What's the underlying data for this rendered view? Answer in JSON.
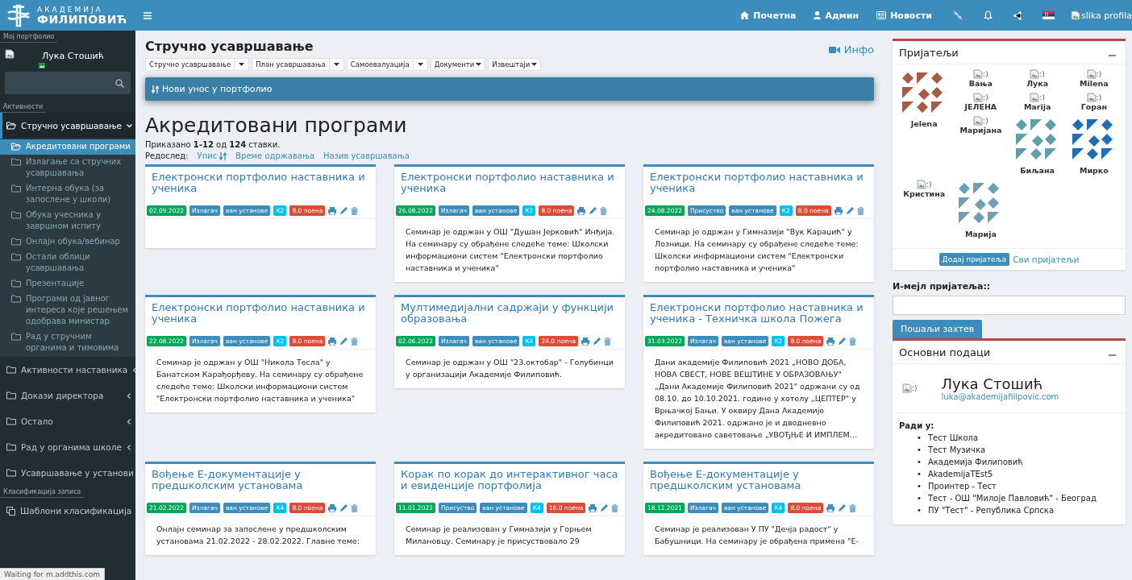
{
  "topbar": {
    "brand_top": "АКАДЕМИЈА",
    "brand_bottom": "ФИЛИПОВИЋ",
    "nav": [
      {
        "label": "Почетна"
      },
      {
        "label": "Админ"
      },
      {
        "label": "Новости"
      }
    ],
    "profile_alt": "slika profila"
  },
  "sidebar": {
    "portfolio_label": "Мој портфолио",
    "user_name": "Лука Стошић",
    "activities_label": "Активности",
    "tree": [
      {
        "label": "Стручно усавршавање",
        "expanded": true,
        "selected": false,
        "children": [
          {
            "label": "Акредитовани програми",
            "selected": true
          },
          {
            "label": "Излагање са стручних усавршавања",
            "selected": false
          },
          {
            "label": "Интерна обука (за запослене у школи)",
            "selected": false
          },
          {
            "label": "Обука учесника у завршном испиту",
            "selected": false
          },
          {
            "label": "Онлајн обука/вебинар",
            "selected": false
          },
          {
            "label": "Остали облици усавршавања",
            "selected": false
          },
          {
            "label": "Презентације",
            "selected": false
          },
          {
            "label": "Програми од јавног интереса које решењем одобрава министар",
            "selected": false
          },
          {
            "label": "Рад у стручним органима и тимовима",
            "selected": false
          }
        ]
      },
      {
        "label": "Активности наставника",
        "expanded": false,
        "selected": false
      },
      {
        "label": "Докази директора",
        "expanded": false,
        "selected": false
      },
      {
        "label": "Остало",
        "expanded": false,
        "selected": false
      },
      {
        "label": "Рад у органима школе",
        "expanded": false,
        "selected": false
      },
      {
        "label": "Усавршавање у установи",
        "expanded": false,
        "selected": false
      }
    ],
    "classification_label": "Класификација записа",
    "templates": "Шаблони класификација"
  },
  "page": {
    "title": "Стручно усавршавање",
    "info": "Инфо",
    "menus": [
      {
        "label": "Стручно усавршавање",
        "split": true
      },
      {
        "label": "План усавршавања",
        "split": true
      },
      {
        "label": "Самоевалуација",
        "split": true
      },
      {
        "label": "Документи",
        "split": false
      },
      {
        "label": "Извештаји",
        "split": false
      }
    ],
    "new_entry": "Нови унос у портфолио",
    "heading": "Акредитовани програми",
    "summary": "Приказано **1-12** од **124** ставки.",
    "sort_label": "Редослед:",
    "sort_links": [
      {
        "label": "Упис",
        "sorted": true
      },
      {
        "label": "Време одржавања",
        "sorted": false
      },
      {
        "label": "Назив усавршавања",
        "sorted": false
      }
    ]
  },
  "cards": [
    {
      "title": "Електронски портфолио наставника и ученика",
      "date": "02.09.2022",
      "role": "Излагач",
      "place": "ван установе",
      "level": "К2",
      "points": "8.0 поена"
    },
    {
      "title": "Електронски портфолио наставника и ученика",
      "date": "26.08.2022",
      "role": "Излагач",
      "place": "ван установе",
      "level": "К2",
      "points": "8.0 поена",
      "description": "Семинар је одржан у ОШ \"Душан Јерковић\" Инђија. На семинару су обрађене следеће теме: Школски информациони систем \"Електронски портфолио наставника и ученика\""
    },
    {
      "title": "Електронски портфолио наставника и ученика",
      "date": "24.08.2022",
      "role": "Присуство",
      "place": "ван установе",
      "level": "К2",
      "points": "8.0 поена",
      "description": "Семинар је одржан у Гимназији \"Вук Караџић\" у Лозници.  На семинару су обрађене следеће теме: Школски информациони систем \"Електронски портфолио наставника и ученика\""
    },
    {
      "title": "Електронски портфолио наставника и ученика",
      "date": "22.08.2022",
      "role": "Излагач",
      "place": "ван установе",
      "level": "К2",
      "points": "8.0 поена",
      "description": "Семинар је одржан у ОШ \"Никола Тесла\"  у Банатском Карађорђеву.  На семинару су обрађене следеће теме: Школски информациони систем \"Електронски портфолио наставника и ученика\""
    },
    {
      "title": "Мултимедијални садржаји у функцији образовања",
      "date": "02.06.2022",
      "role": "Излагач",
      "place": "ван установе",
      "level": "К4",
      "points": "24.0 поена",
      "description": "Семинар је одржан у ОШ \"23.октобар\" - Голубинци у организацији Академије Филиповић."
    },
    {
      "title": "Електронски портфолио наставника и ученика - Техничка школа Пожега",
      "date": "31.03.2022",
      "role": "Излагач",
      "place": "ван установе",
      "level": "К2",
      "points": "8.0 поена",
      "description": "Дани академије Филиповић 2021 „НОВО ДОБА, НОВА СВЕСТ, НОВЕ ВЕШТИНЕ У ОБРАЗОВАЊУ\" „Дани Академије Филиповић 2021\" одржани су од 08.10. до 10.10.2021. године у хотелу „ЦЕПТЕР\" у Врњачкој Бањи. У оквиру Дана Академије Филиповић 2021. одржано је и дводневно акредитовано саветовање „УВОЂЊЕ И ИМПЛЕМ…"
    },
    {
      "title": "Вођење Е-документације у предшколским установама",
      "date": "21.02.2022",
      "role": "Излагач",
      "place": "ван установе",
      "level": "К4",
      "points": "8.0 поена",
      "description": "Онлајн семинар за запослене у предшколским установама 21.02.2022 - 28.02.2022. Главне теме:"
    },
    {
      "title": "Корак по корак до интерактивног часа и евиденције портфолија",
      "date": "11.01.2022",
      "role": "Присуство",
      "place": "ван установе",
      "level": "К4",
      "points": "16.0 поена",
      "description": "Семинар је реализован у Гимназији у Горњем Милановцу. Семинару је присуствовало 29"
    },
    {
      "title": "Вођење Е-документације у предшколским установама",
      "date": "18.12.2021",
      "role": "Излагач",
      "place": "ван установе",
      "level": "К4",
      "points": "8.0 поена",
      "description": "Семинар је реализован У ПУ \"Дечја радост\" у Бабушници. На семинару је обрађена примена \"Е-"
    }
  ],
  "friends": {
    "title": "Пријатељи",
    "people": [
      {
        "name": "Jelena",
        "kind": "pattern",
        "color": "#a85a45"
      },
      {
        "name": "Вања",
        "kind": "broken",
        "alt": ":)"
      },
      {
        "name": "Лука",
        "kind": "broken",
        "alt": ":)"
      },
      {
        "name": "Milena",
        "kind": "broken",
        "alt": ":)"
      },
      {
        "name": "ЈЕЛЕНА",
        "kind": "broken",
        "alt": ":)"
      },
      {
        "name": "Marija",
        "kind": "broken",
        "alt": ":)"
      },
      {
        "name": "Горан",
        "kind": "broken",
        "alt": ":)"
      },
      {
        "name": "Маријана",
        "kind": "broken",
        "alt": ":)"
      },
      {
        "name": "Биљана",
        "kind": "pattern",
        "color": "#5f9eaa"
      },
      {
        "name": "Мирко",
        "kind": "pattern",
        "color": "#1e6db5"
      },
      {
        "name": "Кристина",
        "kind": "broken",
        "alt": ":)"
      },
      {
        "name": "Марија",
        "kind": "pattern",
        "color": "#6f9fb3"
      }
    ],
    "add_button": "Додај пријатеља",
    "all_link": "Сви пријатељи"
  },
  "email_form": {
    "label": "И-мејл пријатеља::",
    "button": "Пошаљи захтев"
  },
  "profile": {
    "title": "Основни подаци",
    "photo_alt": ":)",
    "name": "Лука Стошић",
    "email": "luka@akademijafilipovic.com",
    "works_label": "Ради у:",
    "bullet": "•",
    "workplaces": [
      "Тест Школа",
      "Тест Музичка",
      "Академија Филиповић",
      "AkademijaTEst5",
      "Проинтер - Тест",
      "Тест - ОШ \"Милоје Павловић\" - Београд",
      "ПУ \"Тест\" - Република Српска"
    ]
  },
  "status_bar": "Waiting for m.addthis.com"
}
